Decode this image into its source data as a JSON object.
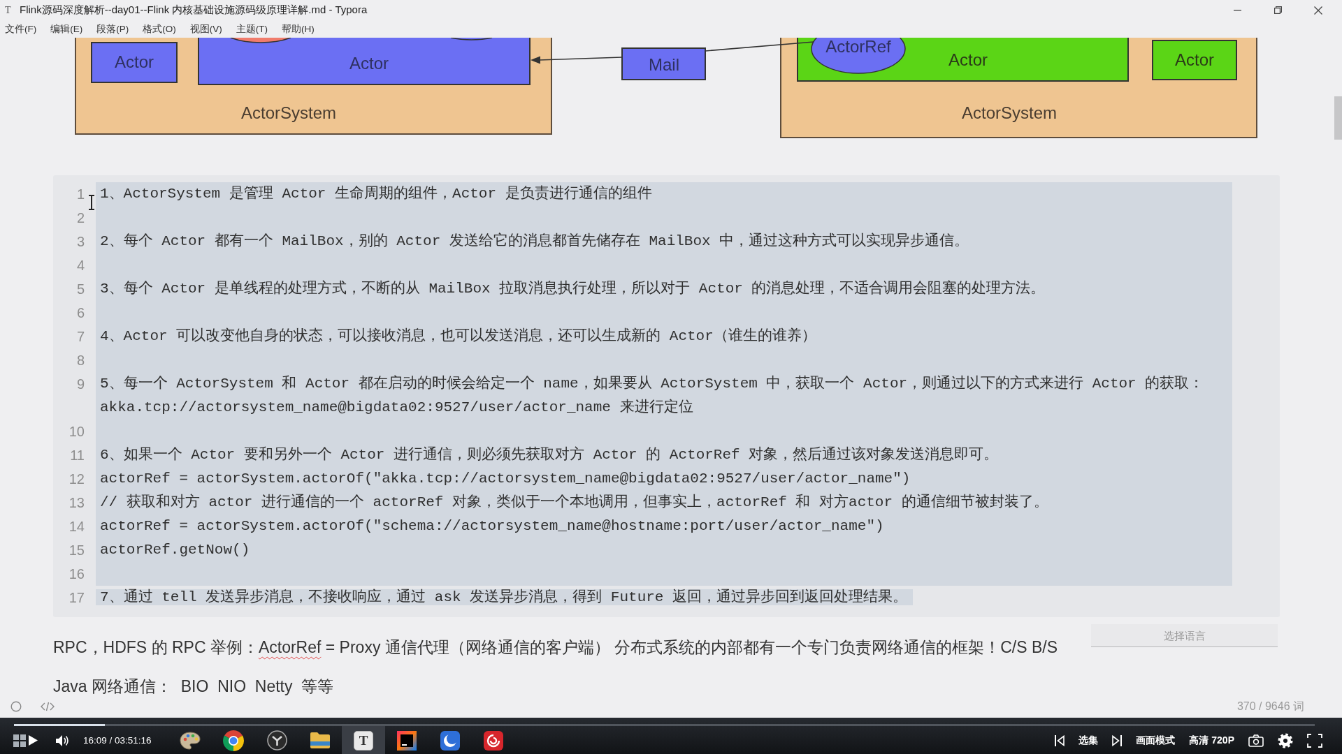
{
  "window": {
    "app_icon": "T",
    "title": "Flink源码深度解析--day01--Flink 内核基础设施源码级原理详解.md - Typora"
  },
  "menu": [
    "文件(F)",
    "编辑(E)",
    "段落(P)",
    "格式(O)",
    "视图(V)",
    "主题(T)",
    "帮助(H)"
  ],
  "diagram": {
    "systems": [
      {
        "label": "ActorSystem"
      },
      {
        "label": "ActorSystem"
      }
    ],
    "actors": [
      {
        "label": "Actor",
        "color": "#6b6ff3"
      },
      {
        "label": "Actor",
        "color": "#6b6ff3"
      },
      {
        "label": "Actor",
        "color": "#5bd516"
      },
      {
        "label": "Actor",
        "color": "#5bd516"
      }
    ],
    "mail": {
      "label": "Mail"
    },
    "actor_ref": {
      "label": "ActorRef"
    }
  },
  "code_block": {
    "lines": [
      {
        "number": "1",
        "text": "1、ActorSystem 是管理 Actor 生命周期的组件，Actor 是负责进行通信的组件",
        "selected": true
      },
      {
        "number": "2",
        "selected": true
      },
      {
        "number": "3",
        "text": "2、每个 Actor 都有一个 MailBox，别的 Actor 发送给它的消息都首先储存在 MailBox 中，通过这种方式可以实现异步通信。",
        "selected": true
      },
      {
        "number": "4",
        "selected": true
      },
      {
        "number": "5",
        "text": "3、每个 Actor 是单线程的处理方式，不断的从 MailBox 拉取消息执行处理，所以对于 Actor 的消息处理，不适合调用会阻塞的处理方法。",
        "selected": true
      },
      {
        "number": "6",
        "selected": true
      },
      {
        "number": "7",
        "text": "4、Actor 可以改变他自身的状态，可以接收消息，也可以发送消息，还可以生成新的 Actor（谁生的谁养）",
        "selected": true
      },
      {
        "number": "8",
        "selected": true
      },
      {
        "number": "9",
        "text": "5、每一个 ActorSystem 和 Actor 都在启动的时候会给定一个 name，如果要从 ActorSystem 中，获取一个 Actor，则通过以下的方式来进行 Actor 的获取： akka.tcp://actorsystem_name@bigdata02:9527/user/actor_name 来进行定位",
        "selected": true
      },
      {
        "number": "10",
        "selected": true
      },
      {
        "number": "11",
        "text": "6、如果一个 Actor 要和另外一个 Actor 进行通信，则必须先获取对方 Actor 的 ActorRef 对象，然后通过该对象发送消息即可。",
        "selected": true
      },
      {
        "number": "12",
        "text": "actorRef = actorSystem.actorOf(\"akka.tcp://actorsystem_name@bigdata02:9527/user/actor_name\")",
        "selected": true
      },
      {
        "number": "13",
        "text": "// 获取和对方 actor 进行通信的一个 actorRef 对象，类似于一个本地调用，但事实上，actorRef 和 对方actor 的通信细节被封装了。",
        "selected": true
      },
      {
        "number": "14",
        "text": "actorRef = actorSystem.actorOf(\"schema://actorsystem_name@hostname:port/user/actor_name\")",
        "selected": true
      },
      {
        "number": "15",
        "text": "actorRef.getNow()",
        "selected": true
      },
      {
        "number": "16",
        "selected": true
      },
      {
        "number": "17",
        "text": "7、通过 tell 发送异步消息，不接收响应，通过 ask 发送异步消息，得到 Future 返回，通过异步回到返回处理结果。",
        "selected": true
      }
    ],
    "language_placeholder": "选择语言"
  },
  "paragraphs": [
    {
      "parts": [
        {
          "text": "RPC，HDFS 的 RPC 举例：",
          "misspelled": false
        },
        {
          "text": "ActorRef",
          "misspelled": true
        },
        {
          "text": " = Proxy 通信代理（网络通信的客户端） 分布式系统的内部都有一个专门负责网络通信的框架！C/S B/S",
          "misspelled": false
        }
      ]
    },
    {
      "parts": [
        {
          "text": "Java 网络通信：  BIO  NIO  Netty  等等",
          "misspelled": false
        }
      ]
    }
  ],
  "status_bar": {
    "word_count": "370 / 9646 词"
  },
  "player": {
    "progress": {
      "level": 0.07
    },
    "playing": false,
    "time": "16:09 / 03:51:16",
    "episodes": "选集",
    "picture_mode": "画面模式",
    "quality": "高清 720P"
  },
  "taskbar": {
    "apps": [
      {
        "kind": "palette",
        "active": false
      },
      {
        "kind": "tricolor",
        "active": false
      },
      {
        "kind": "ring",
        "active": false
      },
      {
        "kind": "folder",
        "active": false
      },
      {
        "kind": "letter",
        "label": "T",
        "active": true
      },
      {
        "kind": "ide",
        "active": false
      },
      {
        "kind": "crescent",
        "active": false
      },
      {
        "kind": "spiral",
        "active": false
      }
    ]
  }
}
